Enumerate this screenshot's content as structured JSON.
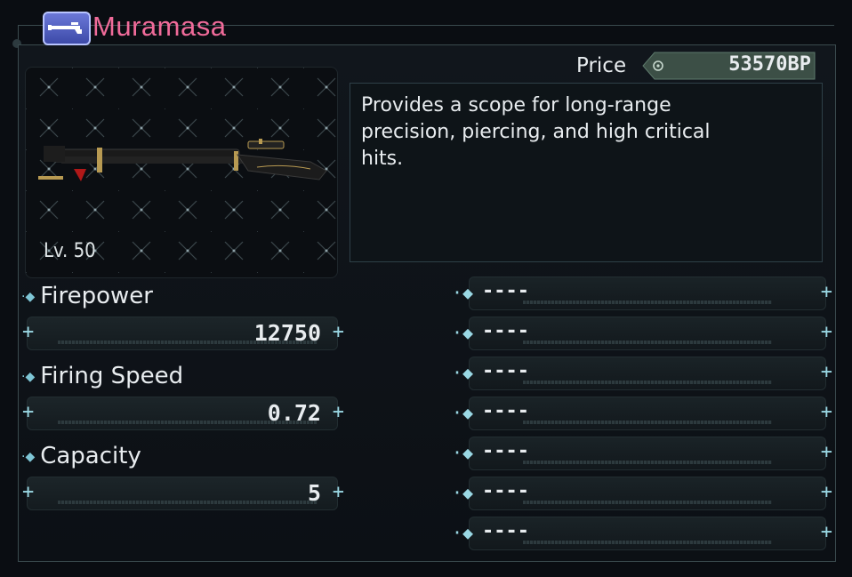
{
  "weapon": {
    "name": "Muramasa",
    "icon": "rifle-icon",
    "level": "Lv. 50"
  },
  "price": {
    "label": "Price",
    "value": "53570BP"
  },
  "description": "Provides a scope for long-range precision, piercing, and high critical hits.",
  "stats": [
    {
      "label": "Firepower",
      "value": "12750"
    },
    {
      "label": "Firing Speed",
      "value": "0.72"
    },
    {
      "label": "Capacity",
      "value": "5"
    }
  ],
  "slots": [
    "----",
    "----",
    "----",
    "----",
    "----",
    "----",
    "----"
  ],
  "colors": {
    "title": "#f06b9a",
    "accent": "#9ad8e4",
    "frame": "#3a4a4e",
    "background": "#0a0d12"
  }
}
